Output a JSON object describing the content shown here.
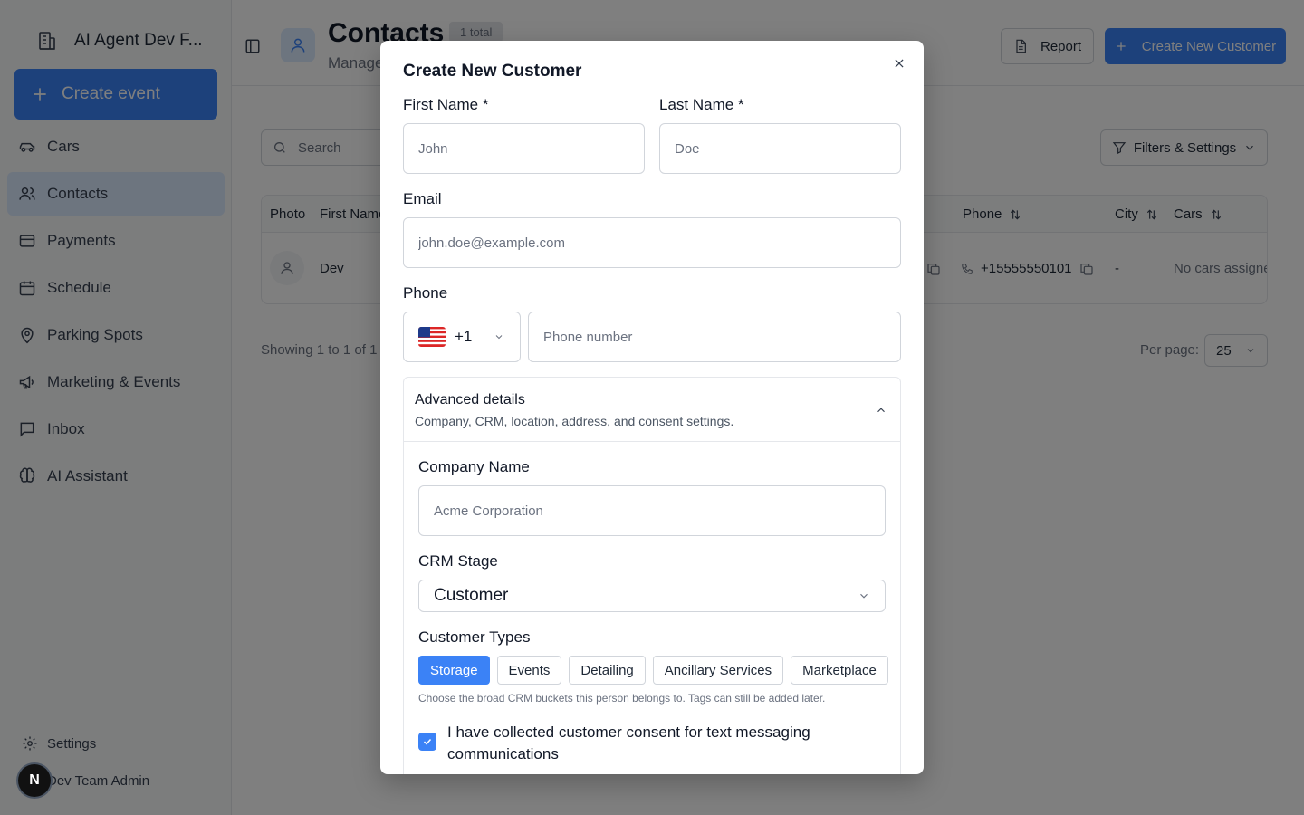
{
  "sidebar": {
    "org_name": "AI Agent Dev F...",
    "create_event_label": "Create event",
    "items": [
      {
        "label": "Cars",
        "icon": "car-icon"
      },
      {
        "label": "Contacts",
        "icon": "users-icon"
      },
      {
        "label": "Payments",
        "icon": "credit-card-icon"
      },
      {
        "label": "Schedule",
        "icon": "calendar-icon"
      },
      {
        "label": "Parking Spots",
        "icon": "map-pin-icon"
      },
      {
        "label": "Marketing & Events",
        "icon": "megaphone-icon"
      },
      {
        "label": "Inbox",
        "icon": "message-square-icon"
      },
      {
        "label": "AI Assistant",
        "icon": "brain-icon"
      }
    ],
    "active_item": "Contacts",
    "settings_label": "Settings",
    "user_initial": "N",
    "user_name": "Dev Team Admin"
  },
  "header": {
    "title": "Contacts",
    "total_badge": "1 total",
    "subtitle": "Manage",
    "report_label": "Report",
    "create_customer_label": "Create New Customer"
  },
  "toolbar": {
    "search_placeholder": "Search",
    "filters_label": "Filters & Settings"
  },
  "table": {
    "columns": [
      "Photo",
      "First Name",
      "Phone",
      "City",
      "Cars"
    ],
    "rows": [
      {
        "first_name": "Dev",
        "phone": "+15555550101",
        "city": "-",
        "cars": "No cars assigne"
      }
    ]
  },
  "pagination": {
    "showing": "Showing 1 to 1 of 1",
    "per_page_label": "Per page:",
    "per_page_value": "25"
  },
  "modal": {
    "title": "Create New Customer",
    "first_name_label": "First Name *",
    "first_name_placeholder": "John",
    "last_name_label": "Last Name *",
    "last_name_placeholder": "Doe",
    "email_label": "Email",
    "email_placeholder": "john.doe@example.com",
    "phone_label": "Phone",
    "country_code": "+1",
    "phone_placeholder": "Phone number",
    "advanced": {
      "title": "Advanced details",
      "subtitle": "Company, CRM, location, address, and consent settings.",
      "company_label": "Company Name",
      "company_placeholder": "Acme Corporation",
      "crm_label": "CRM Stage",
      "crm_value": "Customer",
      "types_label": "Customer Types",
      "types": [
        {
          "label": "Storage",
          "selected": true
        },
        {
          "label": "Events",
          "selected": false
        },
        {
          "label": "Detailing",
          "selected": false
        },
        {
          "label": "Ancillary Services",
          "selected": false
        },
        {
          "label": "Marketplace",
          "selected": false
        }
      ],
      "types_hint": "Choose the broad CRM buckets this person belongs to. Tags can still be added later.",
      "consent_text": "I have collected customer consent for text messaging communications",
      "consent_checked": true
    }
  },
  "colors": {
    "accent": "#3b82f6",
    "active_nav_bg": "#dbeafe"
  }
}
